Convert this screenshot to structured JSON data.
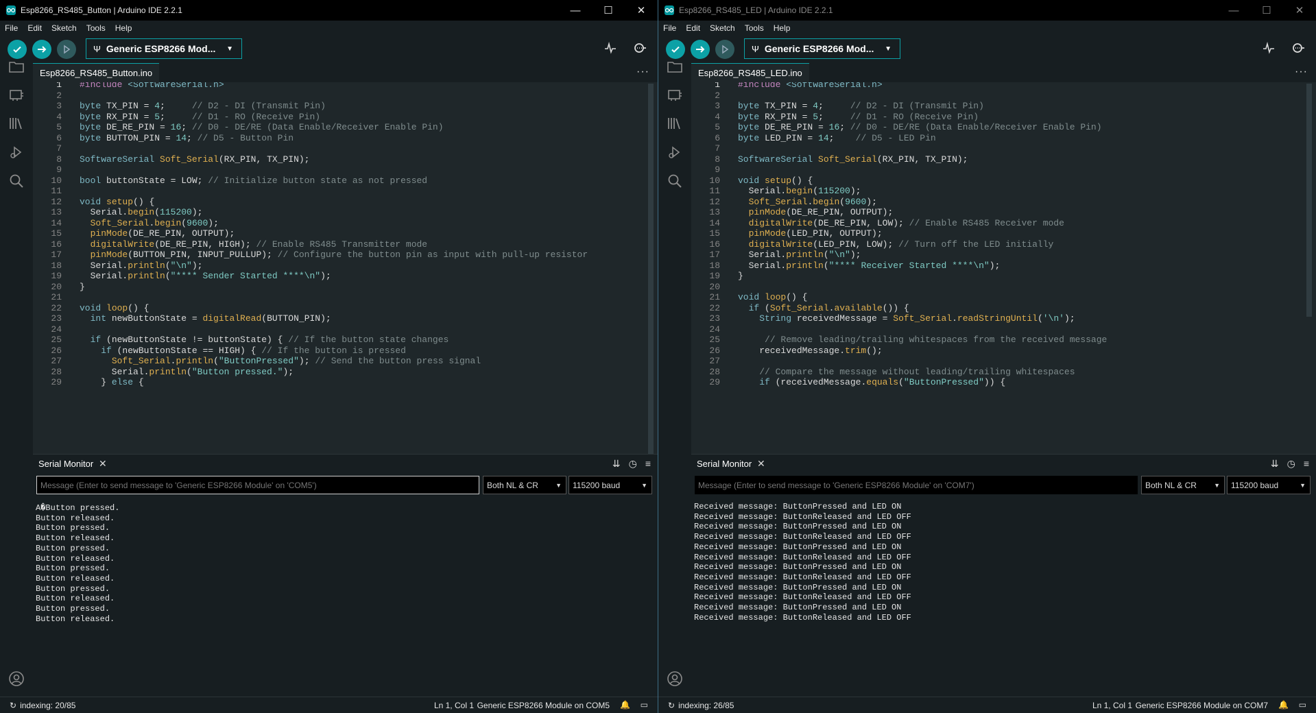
{
  "colors": {
    "accent": "#0ca1a6",
    "background": "#1f272a",
    "panel": "#171e21"
  },
  "windows": [
    {
      "title": "Esp8266_RS485_Button | Arduino IDE 2.2.1",
      "menu": [
        "File",
        "Edit",
        "Sketch",
        "Tools",
        "Help"
      ],
      "board": "Generic ESP8266 Mod...",
      "file_tab": "Esp8266_RS485_Button.ino",
      "code": [
        {
          "n": "1",
          "t": "#include <SoftwareSerial.h>"
        },
        {
          "n": "2",
          "t": ""
        },
        {
          "n": "3",
          "t": "byte TX_PIN = 4;     // D2 - DI (Transmit Pin)"
        },
        {
          "n": "4",
          "t": "byte RX_PIN = 5;     // D1 - RO (Receive Pin)"
        },
        {
          "n": "5",
          "t": "byte DE_RE_PIN = 16; // D0 - DE/RE (Data Enable/Receiver Enable Pin)"
        },
        {
          "n": "6",
          "t": "byte BUTTON_PIN = 14; // D5 - Button Pin"
        },
        {
          "n": "7",
          "t": ""
        },
        {
          "n": "8",
          "t": "SoftwareSerial Soft_Serial(RX_PIN, TX_PIN);"
        },
        {
          "n": "9",
          "t": ""
        },
        {
          "n": "10",
          "t": "bool buttonState = LOW; // Initialize button state as not pressed"
        },
        {
          "n": "11",
          "t": ""
        },
        {
          "n": "12",
          "t": "void setup() {"
        },
        {
          "n": "13",
          "t": "  Serial.begin(115200);"
        },
        {
          "n": "14",
          "t": "  Soft_Serial.begin(9600);"
        },
        {
          "n": "15",
          "t": "  pinMode(DE_RE_PIN, OUTPUT);"
        },
        {
          "n": "16",
          "t": "  digitalWrite(DE_RE_PIN, HIGH); // Enable RS485 Transmitter mode"
        },
        {
          "n": "17",
          "t": "  pinMode(BUTTON_PIN, INPUT_PULLUP); // Configure the button pin as input with pull-up resistor"
        },
        {
          "n": "18",
          "t": "  Serial.println(\"\\n\");"
        },
        {
          "n": "19",
          "t": "  Serial.println(\"**** Sender Started ****\\n\");"
        },
        {
          "n": "20",
          "t": "}"
        },
        {
          "n": "21",
          "t": ""
        },
        {
          "n": "22",
          "t": "void loop() {"
        },
        {
          "n": "23",
          "t": "  int newButtonState = digitalRead(BUTTON_PIN);"
        },
        {
          "n": "24",
          "t": ""
        },
        {
          "n": "25",
          "t": "  if (newButtonState != buttonState) { // If the button state changes"
        },
        {
          "n": "26",
          "t": "    if (newButtonState == HIGH) { // If the button is pressed"
        },
        {
          "n": "27",
          "t": "      Soft_Serial.println(\"ButtonPressed\"); // Send the button press signal"
        },
        {
          "n": "28",
          "t": "      Serial.println(\"Button pressed.\");"
        },
        {
          "n": "29",
          "t": "    } else {"
        }
      ],
      "serial_monitor": {
        "title": "Serial Monitor",
        "placeholder": "Message (Enter to send message to 'Generic ESP8266 Module' on 'COM5')",
        "line_ending": "Both NL & CR",
        "baud": "115200 baud",
        "output": [
          "A�Button pressed.",
          "Button released.",
          "Button pressed.",
          "Button released.",
          "Button pressed.",
          "Button released.",
          "Button pressed.",
          "Button released.",
          "Button pressed.",
          "Button released.",
          "Button pressed.",
          "Button released."
        ]
      },
      "status": {
        "indexing": "indexing: 20/85",
        "position": "Ln 1, Col 1",
        "board": "Generic ESP8266 Module on COM5"
      }
    },
    {
      "title": "Esp8266_RS485_LED | Arduino IDE 2.2.1",
      "menu": [
        "File",
        "Edit",
        "Sketch",
        "Tools",
        "Help"
      ],
      "board": "Generic ESP8266 Mod...",
      "file_tab": "Esp8266_RS485_LED.ino",
      "code": [
        {
          "n": "1",
          "t": "#include <SoftwareSerial.h>"
        },
        {
          "n": "2",
          "t": ""
        },
        {
          "n": "3",
          "t": "byte TX_PIN = 4;     // D2 - DI (Transmit Pin)"
        },
        {
          "n": "4",
          "t": "byte RX_PIN = 5;     // D1 - RO (Receive Pin)"
        },
        {
          "n": "5",
          "t": "byte DE_RE_PIN = 16; // D0 - DE/RE (Data Enable/Receiver Enable Pin)"
        },
        {
          "n": "6",
          "t": "byte LED_PIN = 14;    // D5 - LED Pin"
        },
        {
          "n": "7",
          "t": ""
        },
        {
          "n": "8",
          "t": "SoftwareSerial Soft_Serial(RX_PIN, TX_PIN);"
        },
        {
          "n": "9",
          "t": ""
        },
        {
          "n": "10",
          "t": "void setup() {"
        },
        {
          "n": "11",
          "t": "  Serial.begin(115200);"
        },
        {
          "n": "12",
          "t": "  Soft_Serial.begin(9600);"
        },
        {
          "n": "13",
          "t": "  pinMode(DE_RE_PIN, OUTPUT);"
        },
        {
          "n": "14",
          "t": "  digitalWrite(DE_RE_PIN, LOW); // Enable RS485 Receiver mode"
        },
        {
          "n": "15",
          "t": "  pinMode(LED_PIN, OUTPUT);"
        },
        {
          "n": "16",
          "t": "  digitalWrite(LED_PIN, LOW); // Turn off the LED initially"
        },
        {
          "n": "17",
          "t": "  Serial.println(\"\\n\");"
        },
        {
          "n": "18",
          "t": "  Serial.println(\"**** Receiver Started ****\\n\");"
        },
        {
          "n": "19",
          "t": "}"
        },
        {
          "n": "20",
          "t": ""
        },
        {
          "n": "21",
          "t": "void loop() {"
        },
        {
          "n": "22",
          "t": "  if (Soft_Serial.available()) {"
        },
        {
          "n": "23",
          "t": "    String receivedMessage = Soft_Serial.readStringUntil('\\n');"
        },
        {
          "n": "24",
          "t": ""
        },
        {
          "n": "25",
          "t": "     // Remove leading/trailing whitespaces from the received message"
        },
        {
          "n": "26",
          "t": "    receivedMessage.trim();"
        },
        {
          "n": "27",
          "t": ""
        },
        {
          "n": "28",
          "t": "    // Compare the message without leading/trailing whitespaces"
        },
        {
          "n": "29",
          "t": "    if (receivedMessage.equals(\"ButtonPressed\")) {"
        }
      ],
      "serial_monitor": {
        "title": "Serial Monitor",
        "placeholder": "Message (Enter to send message to 'Generic ESP8266 Module' on 'COM7')",
        "line_ending": "Both NL & CR",
        "baud": "115200 baud",
        "output": [
          "Received message: ButtonPressed and LED ON",
          "Received message: ButtonReleased and LED OFF",
          "Received message: ButtonPressed and LED ON",
          "Received message: ButtonReleased and LED OFF",
          "Received message: ButtonPressed and LED ON",
          "Received message: ButtonReleased and LED OFF",
          "Received message: ButtonPressed and LED ON",
          "Received message: ButtonReleased and LED OFF",
          "Received message: ButtonPressed and LED ON",
          "Received message: ButtonReleased and LED OFF",
          "Received message: ButtonPressed and LED ON",
          "Received message: ButtonReleased and LED OFF"
        ]
      },
      "status": {
        "indexing": "indexing: 26/85",
        "position": "Ln 1, Col 1",
        "board": "Generic ESP8266 Module on COM7"
      }
    }
  ]
}
